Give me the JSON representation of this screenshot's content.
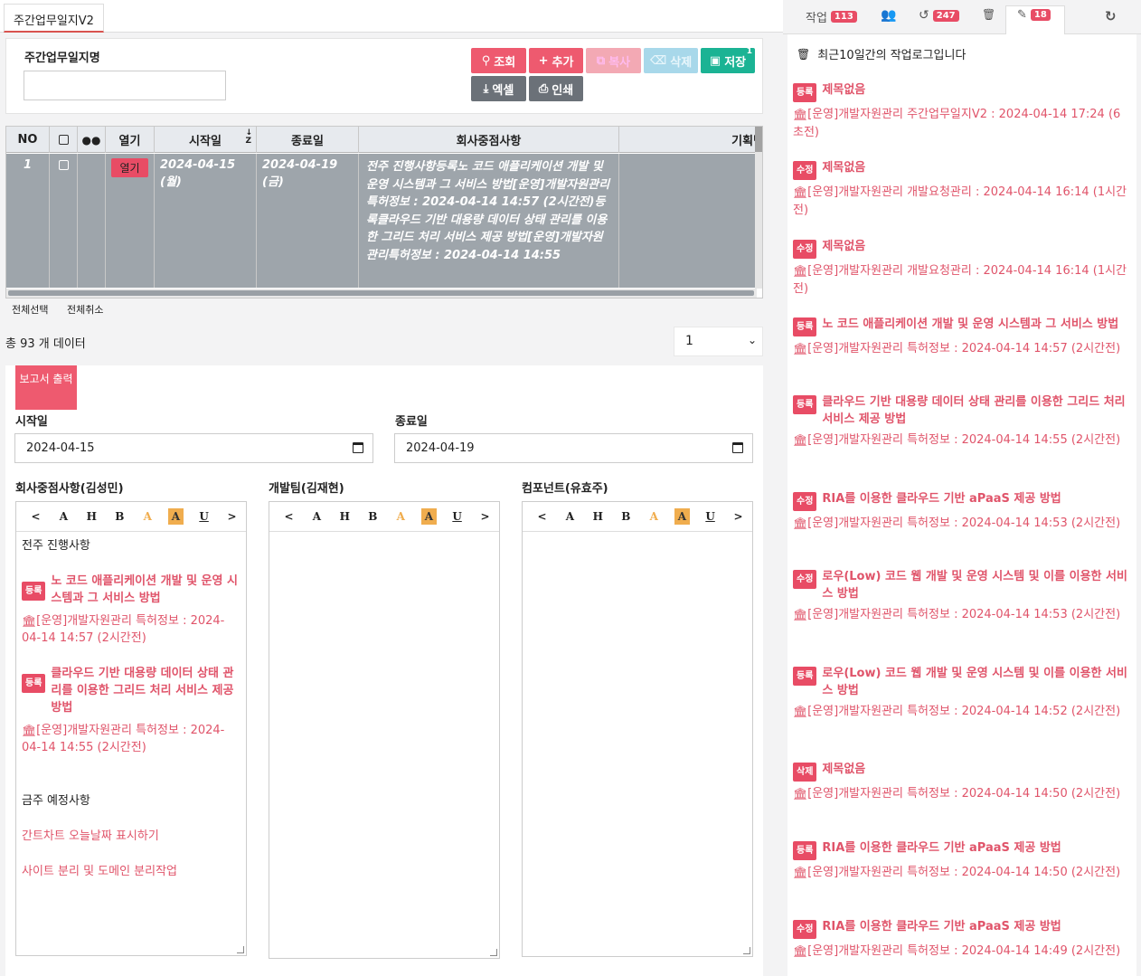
{
  "tab": {
    "title": "주간업무일지V2"
  },
  "search": {
    "label": "주간업무일지명",
    "value": ""
  },
  "toolbar": {
    "search": "조회",
    "add": "추가",
    "copy": "복사",
    "delete": "삭제",
    "save": "저장",
    "save_sup": "1",
    "excel": "엑셀",
    "print": "인쇄"
  },
  "grid": {
    "columns": [
      "NO",
      "",
      "",
      "열기",
      "시작일",
      "종료일",
      "회사중점사항",
      "기획팀"
    ],
    "row": {
      "no": "1",
      "open": "열기",
      "start": "2024-04-15 (월)",
      "end": "2024-04-19 (금)",
      "focus": "전주 진행사항등록노 코드 애플리케이션 개발 및 운영 시스템과 그 서비스 방법[운영]개발자원관리특허정보 : 2024-04-14 14:57 (2시간전)등록클라우드 기반 대용량 데이터 상태 관리를 이용한 그리드 처리 서비스 제공 방법[운영]개발자원관리특허정보 : 2024-04-14 14:55"
    }
  },
  "links": {
    "select_all": "전체선택",
    "deselect_all": "전체취소"
  },
  "total": "총 93 개 데이터",
  "page": "1",
  "form": {
    "report_btn": "보고서 출력",
    "start_label": "시작일",
    "start_value": "2024-04-15",
    "end_label": "종료일",
    "end_value": "2024-04-19",
    "editors": [
      {
        "label": "회사중점사항(김성민)"
      },
      {
        "label": "개발팀(김재현)"
      },
      {
        "label": "컴포넌트(유효주)"
      }
    ],
    "toolbar_btns": [
      "<",
      "A",
      "H",
      "B",
      "A",
      "A",
      "U",
      ">"
    ],
    "editor1": {
      "h1": "전주 진행사항",
      "i1_badge": "등록",
      "i1_title": "노 코드 애플리케이션 개발 및 운영 시스템과 그 서비스 방법",
      "i1_meta": "[운영]개발자원관리 특허정보 : 2024-04-14 14:57 (2시간전)",
      "i2_badge": "등록",
      "i2_title": "클라우드 기반 대용량 데이터 상태 관리를 이용한 그리드 처리 서비스 제공 방법",
      "i2_meta": "[운영]개발자원관리 특허정보 : 2024-04-14 14:55 (2시간전)",
      "h2": "금주 예정사항",
      "p1": "간트차트 오늘날짜 표시하기",
      "p2": "사이트 분리 및 도메인 분리작업"
    }
  },
  "right": {
    "tabs": [
      {
        "label": "작업",
        "count": "113"
      },
      {
        "label": "",
        "count": ""
      },
      {
        "label": "",
        "count": "247"
      },
      {
        "label": "",
        "count": ""
      },
      {
        "label": "",
        "count": "18"
      }
    ],
    "header": "최근10일간의 작업로그입니다",
    "items": [
      {
        "badge": "등록",
        "title": "제목없음",
        "meta": "[운영]개발자원관리 주간업무일지V2 : 2024-04-14 17:24 (6초전)"
      },
      {
        "badge": "수정",
        "title": "제목없음",
        "meta": "[운영]개발자원관리 개발요청관리 : 2024-04-14 16:14 (1시간전)"
      },
      {
        "badge": "수정",
        "title": "제목없음",
        "meta": "[운영]개발자원관리 개발요청관리 : 2024-04-14 16:14 (1시간전)"
      },
      {
        "badge": "등록",
        "title": "노 코드 애플리케이션 개발 및 운영 시스템과 그 서비스 방법",
        "meta": "[운영]개발자원관리 특허정보 : 2024-04-14 14:57 (2시간전)"
      },
      {
        "badge": "등록",
        "title": "클라우드 기반 대용량 데이터 상태 관리를 이용한 그리드 처리 서비스 제공 방법",
        "meta": "[운영]개발자원관리 특허정보 : 2024-04-14 14:55 (2시간전)"
      },
      {
        "badge": "수정",
        "title": "RIA를 이용한 클라우드 기반 aPaaS 제공 방법",
        "meta": "[운영]개발자원관리 특허정보 : 2024-04-14 14:53 (2시간전)"
      },
      {
        "badge": "수정",
        "title": "로우(Low) 코드 웹 개발 및 운영 시스템 및 이를 이용한 서비스 방법",
        "meta": "[운영]개발자원관리 특허정보 : 2024-04-14 14:53 (2시간전)"
      },
      {
        "badge": "등록",
        "title": "로우(Low) 코드 웹 개발 및 운영 시스템 및 이를 이용한 서비스 방법",
        "meta": "[운영]개발자원관리 특허정보 : 2024-04-14 14:52 (2시간전)"
      },
      {
        "badge": "삭제",
        "title": "제목없음",
        "meta": "[운영]개발자원관리 특허정보 : 2024-04-14 14:50 (2시간전)"
      },
      {
        "badge": "등록",
        "title": "RIA를 이용한 클라우드 기반 aPaaS 제공 방법",
        "meta": "[운영]개발자원관리 특허정보 : 2024-04-14 14:50 (2시간전)"
      },
      {
        "badge": "수정",
        "title": "RIA를 이용한 클라우드 기반 aPaaS 제공 방법",
        "meta": "[운영]개발자원관리 특허정보 : 2024-04-14 14:49 (2시간전)"
      }
    ]
  }
}
